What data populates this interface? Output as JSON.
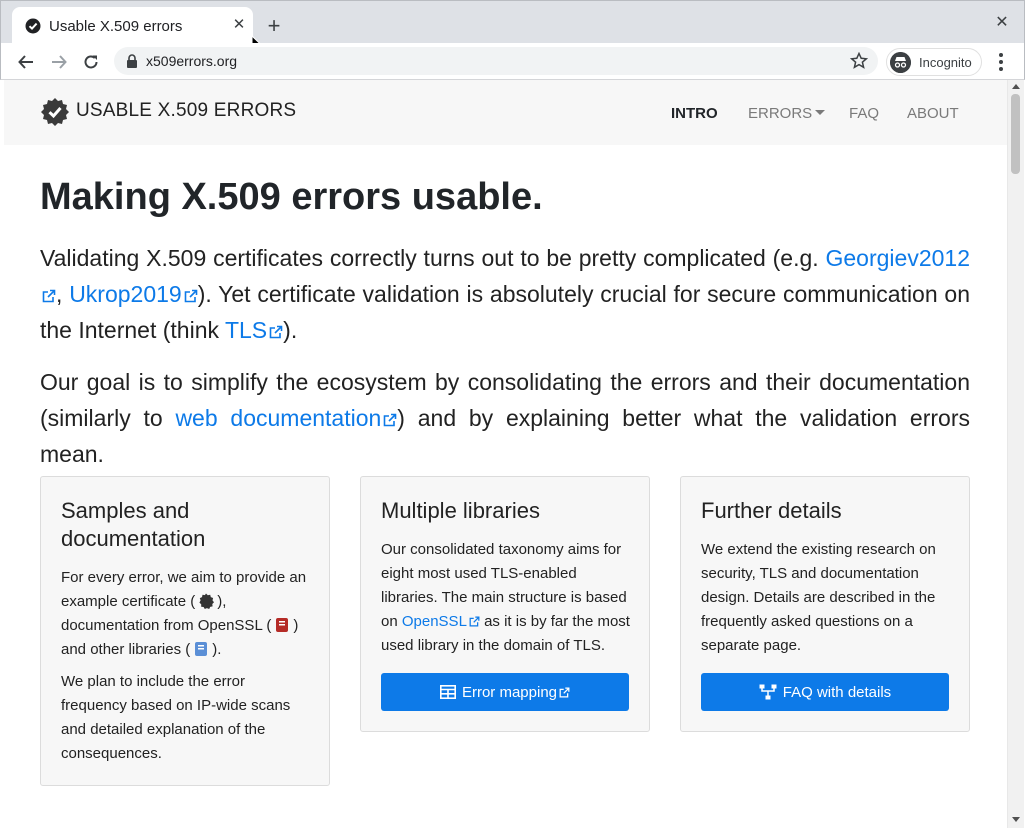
{
  "browser": {
    "tab_title": "Usable X.509 errors",
    "url": "x509errors.org",
    "profile_label": "Incognito"
  },
  "nav": {
    "brand": "USABLE X.509 ERRORS",
    "links": [
      "INTRO",
      "ERRORS",
      "FAQ",
      "ABOUT"
    ]
  },
  "main": {
    "title": "Making X.509 errors usable.",
    "p1": {
      "t1": "Validating X.509 certificates correctly turns out to be pretty complicated (e.g. ",
      "link1": "Georgiev2012",
      "t2": ", ",
      "link2": "Ukrop2019",
      "t3": "). Yet certificate validation is absolutely crucial for secure communication on the Internet (think ",
      "link3": "TLS",
      "t4": ")."
    },
    "p2": {
      "t1": "Our goal is to simplify the ecosystem by consolidating the errors and their documentation (similarly to ",
      "link1": "web documentation",
      "t2": ") and by explaining better what the validation errors mean."
    }
  },
  "cards": [
    {
      "title": "Samples and documentation",
      "t1": "For every error, we aim to provide an example certificate (",
      "t2": "), documentation from OpenSSL (",
      "t3": ") and other libraries (",
      "t4": ").",
      "text2": "We plan to include the error frequency based on IP-wide scans and detailed explanation of the consequences."
    },
    {
      "title": "Multiple libraries",
      "t1": "Our consolidated taxonomy aims for eight most used TLS-enabled libraries. The main structure is based on ",
      "link": "OpenSSL",
      "t2": " as it is by far the most used library in the domain of TLS.",
      "button": "Error mapping"
    },
    {
      "title": "Further details",
      "text": "We extend the existing research on security, TLS and documentation design. Details are described in the frequently asked questions on a separate page.",
      "button": "FAQ with details"
    }
  ],
  "colors": {
    "link": "#0d7ae8",
    "button": "#0d7ae8",
    "navbar": "#f7f7f7",
    "card": "#f7f7f7"
  }
}
